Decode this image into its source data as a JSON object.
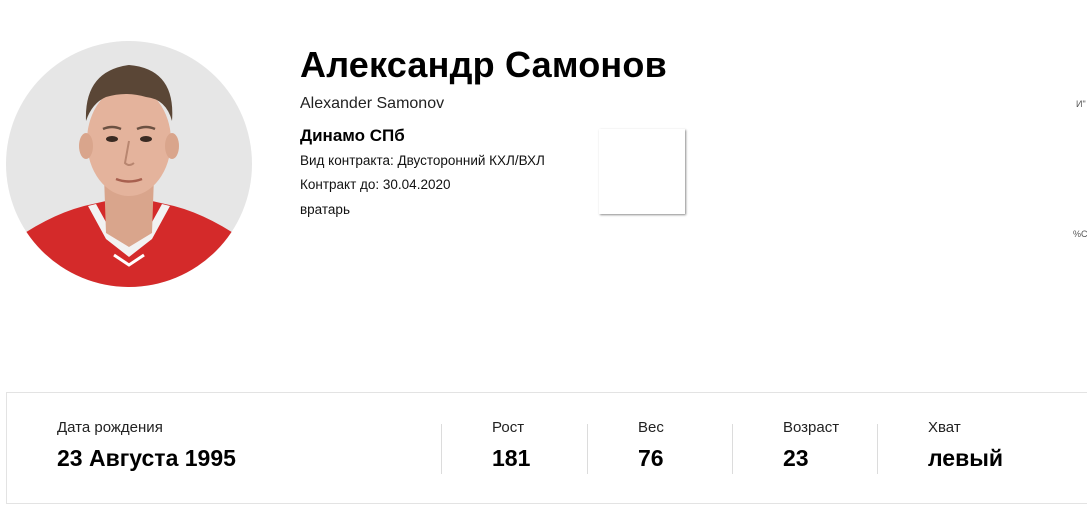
{
  "player": {
    "name": "Александр Самонов",
    "name_en": "Alexander Samonov",
    "team": "Динамо СПб",
    "contract_type": "Вид контракта: Двусторонний КХЛ/ВХЛ",
    "contract_until": "Контракт до: 30.04.2020",
    "position": "вратарь"
  },
  "edge_text": {
    "top": "И\"",
    "bottom": "%С"
  },
  "stats": [
    {
      "label": "Дата рождения",
      "value": "23 Августа 1995"
    },
    {
      "label": "Рост",
      "value": "181"
    },
    {
      "label": "Вес",
      "value": "76"
    },
    {
      "label": "Возраст",
      "value": "23"
    },
    {
      "label": "Хват",
      "value": "левый"
    }
  ],
  "colors": {
    "avatar_bg": "#e6e6e6",
    "jersey_red": "#d42a2a",
    "card_border": "#e3e3e3",
    "divider": "#dcdcdc"
  }
}
